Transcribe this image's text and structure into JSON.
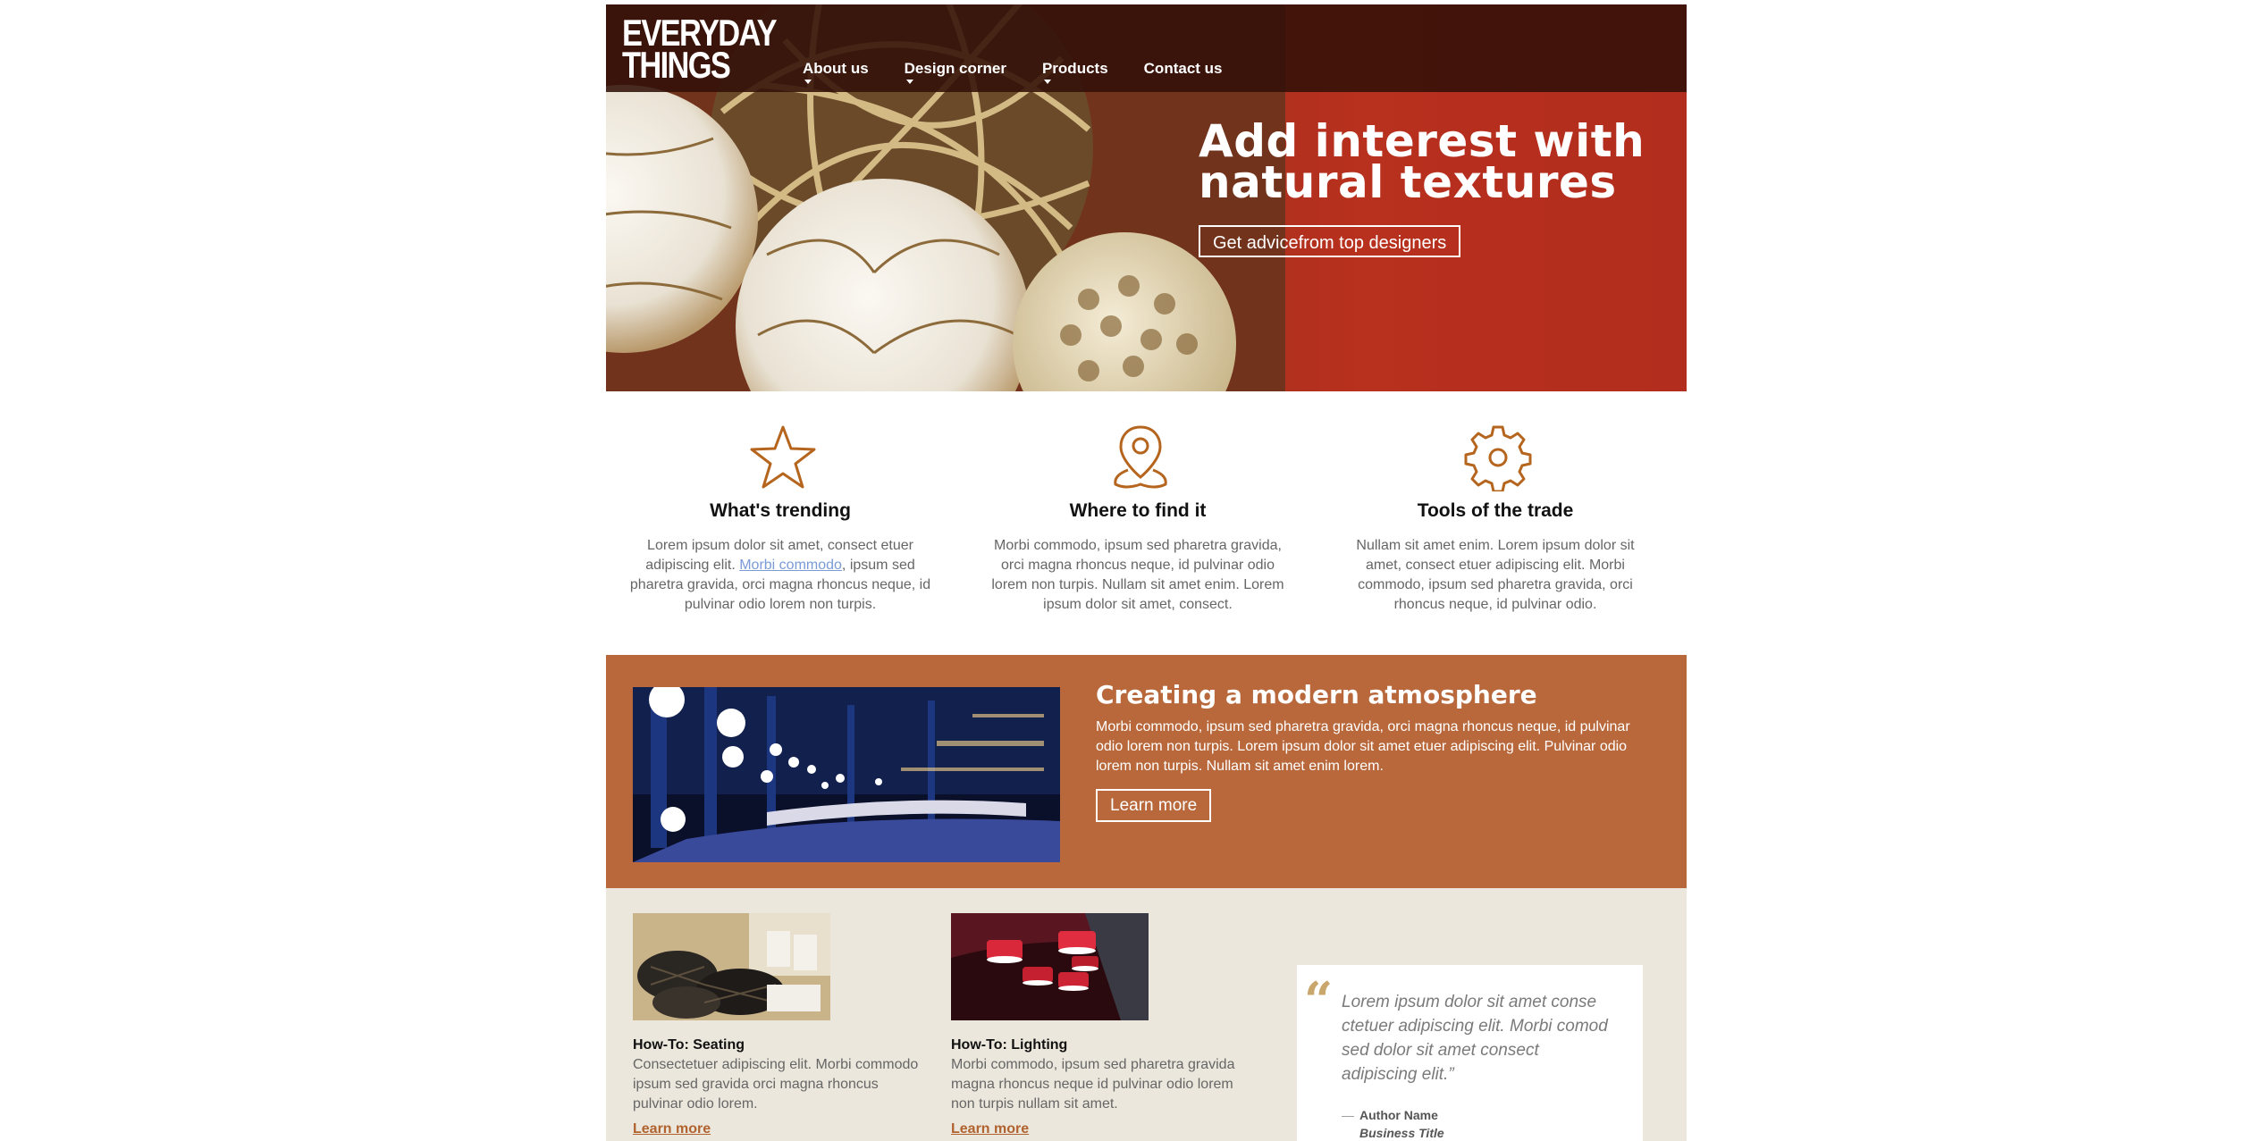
{
  "header": {
    "logo_line1": "EVERYDAY",
    "logo_line2": "THINGS",
    "nav": [
      {
        "label": "About us"
      },
      {
        "label": "Design corner"
      },
      {
        "label": "Products"
      },
      {
        "label": "Contact us"
      }
    ]
  },
  "hero": {
    "title_line1": "Add interest with",
    "title_line2": "natural textures",
    "button_label": "Get advicefrom top designers"
  },
  "features": [
    {
      "icon": "star-icon",
      "title": "What's trending",
      "text_before_link": "Lorem ipsum dolor sit amet, consect etuer adipiscing elit. ",
      "link": "Morbi commodo",
      "text_after_link": ", ipsum sed pharetra gravida, orci magna rhoncus neque, id pulvinar odio lorem non turpis."
    },
    {
      "icon": "map-pin-icon",
      "title": "Where to find it",
      "text": "Morbi commodo, ipsum sed pharetra gravida, orci magna rhoncus neque, id pulvinar odio lorem non turpis. Nullam sit amet enim. Lorem ipsum dolor sit amet, consect."
    },
    {
      "icon": "gear-icon",
      "title": "Tools of the trade",
      "text": "Nullam sit amet enim. Lorem ipsum dolor sit amet, consect etuer adipiscing elit. Morbi commodo, ipsum sed pharetra gravida, orci rhoncus neque, id pulvinar odio."
    }
  ],
  "band": {
    "title": "Creating a modern atmosphere",
    "text": "Morbi commodo, ipsum sed pharetra gravida, orci magna rhoncus neque, id pulvinar odio lorem non turpis. Lorem ipsum dolor sit amet etuer adipiscing elit. Pulvinar odio lorem non turpis. Nullam sit amet enim lorem.",
    "button_label": "Learn more"
  },
  "cards": [
    {
      "title": "How-To: Seating",
      "text": "Consectetuer adipiscing elit. Morbi commodo ipsum sed gravida orci magna rhoncus pulvinar odio lorem.",
      "link": "Learn more"
    },
    {
      "title": "How-To: Lighting",
      "text": "Morbi commodo, ipsum sed pharetra gravida magna rhoncus neque id pulvinar odio lorem non turpis nullam sit amet.",
      "link": "Learn more"
    }
  ],
  "quote": {
    "text": "Lorem ipsum dolor sit amet conse ctetuer adipiscing elit. Morbi comod sed dolor sit amet consect adipiscing elit.”",
    "author": "Author Name",
    "title": "Business Title"
  },
  "colors": {
    "accent_orange": "#b8683b",
    "icon_orange": "#b5651d",
    "hero_red": "#b22d1d",
    "topbar_dark": "#321008",
    "bottom_bg": "#ece7dc"
  }
}
